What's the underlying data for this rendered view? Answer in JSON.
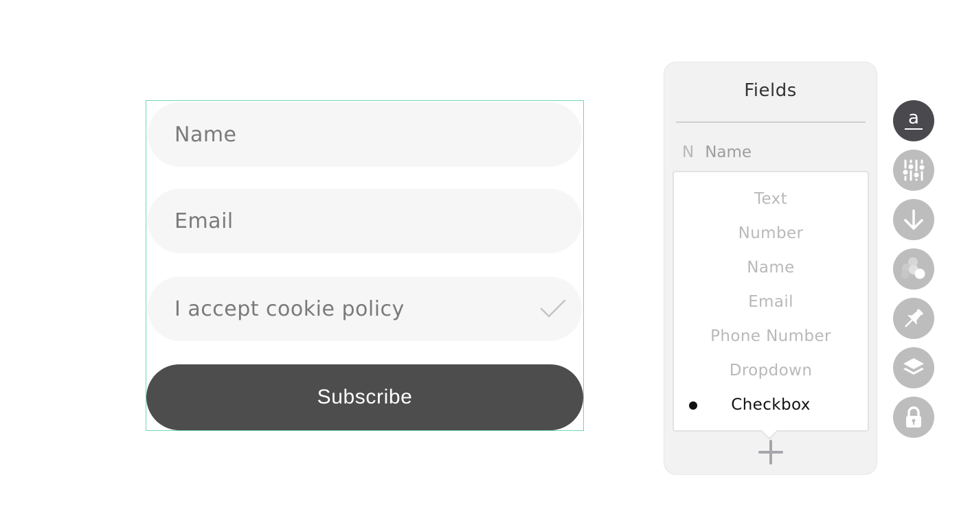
{
  "form": {
    "fields": [
      {
        "label": "Name"
      },
      {
        "label": "Email"
      },
      {
        "label": "I accept cookie policy",
        "type": "checkbox"
      }
    ],
    "subscribe_label": "Subscribe"
  },
  "panel": {
    "title": "Fields",
    "field_row": {
      "icon_letter": "N",
      "label": "Name"
    },
    "types": [
      {
        "label": "Text",
        "selected": false
      },
      {
        "label": "Number",
        "selected": false
      },
      {
        "label": "Name",
        "selected": false
      },
      {
        "label": "Email",
        "selected": false
      },
      {
        "label": "Phone Number",
        "selected": false
      },
      {
        "label": "Dropdown",
        "selected": false
      },
      {
        "label": "Checkbox",
        "selected": true
      }
    ],
    "add_icon": "plus-icon"
  },
  "tools": {
    "text_icon_glyph": "a",
    "items": [
      {
        "icon": "text-style-icon",
        "active": true
      },
      {
        "icon": "adjust-sliders-icon",
        "active": false
      },
      {
        "icon": "download-arrow-icon",
        "active": false
      },
      {
        "icon": "effects-bubbles-icon",
        "active": false
      },
      {
        "icon": "pin-icon",
        "active": false
      },
      {
        "icon": "layers-icon",
        "active": false
      },
      {
        "icon": "lock-icon",
        "active": false
      }
    ]
  },
  "colors": {
    "frame_border": "#6fd6b4",
    "button_bg": "#4d4d4d",
    "field_bg": "#f6f6f6",
    "active_tool_bg": "#4a4a4e",
    "tool_bg": "#bdbdbd"
  }
}
